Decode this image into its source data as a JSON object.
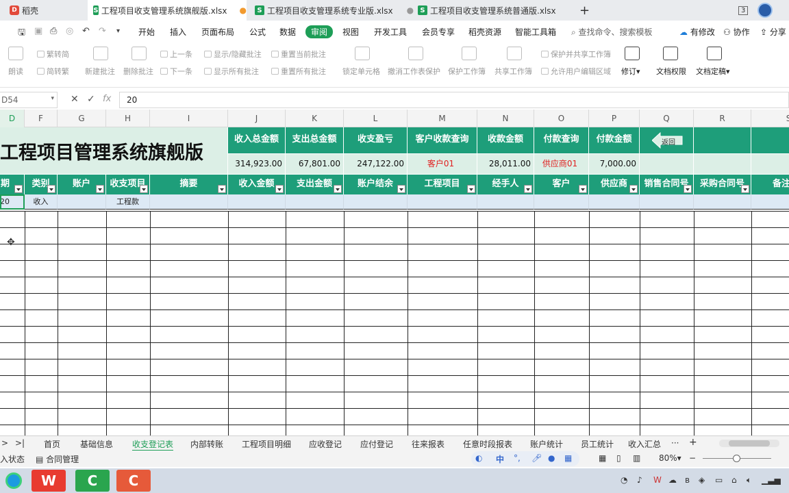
{
  "tabs": [
    {
      "label": "稻壳",
      "type": "docer"
    },
    {
      "label": "工程项目收支管理系统旗舰版.xlsx",
      "active": true,
      "dot": "●"
    },
    {
      "label": "工程项目收支管理系统专业版.xlsx",
      "dot": "●"
    },
    {
      "label": "工程项目收支管理系统普通版.xlsx"
    }
  ],
  "tab_icon": "S",
  "docer_icon": "D",
  "new_tab": "+",
  "tab_count": "3",
  "menu": {
    "items": [
      "开始",
      "插入",
      "页面布局",
      "公式",
      "数据",
      "审阅",
      "视图",
      "开发工具",
      "会员专享",
      "稻壳资源",
      "智能工具箱"
    ],
    "active": "审阅",
    "search": "查找命令、搜索模板",
    "right": [
      "有修改",
      "协作",
      "分享"
    ]
  },
  "ribbon": {
    "read": "朗读",
    "trad": "繁转简",
    "simp": "简转繁",
    "new_comment": "新建批注",
    "del_comment": "删除批注",
    "prev": "上一条",
    "next": "下一条",
    "show_hide": "显示/隐藏批注",
    "show_all": "显示所有批注",
    "reset_cur": "重置当前批注",
    "reset_all": "重置所有批注",
    "lock_cell": "锁定单元格",
    "unprotect": "撤消工作表保护",
    "protect_book": "保护工作簿",
    "share_book": "共享工作簿",
    "protect_share": "保护并共享工作簿",
    "allow_edit": "允许用户编辑区域",
    "revise": "修订",
    "doc_rights": "文档权限",
    "doc_final": "文档定稿"
  },
  "formula": {
    "cell_ref": "D54",
    "value": "20",
    "fx": "fx"
  },
  "columns": [
    "D",
    "F",
    "G",
    "H",
    "I",
    "J",
    "K",
    "L",
    "M",
    "N",
    "O",
    "P",
    "Q",
    "R",
    "S"
  ],
  "banner_title": "工程项目管理系统旗舰版",
  "summary": {
    "headers": [
      "收入总金额",
      "支出总金额",
      "收支盈亏",
      "客户收款查询",
      "收款金额",
      "付款查询",
      "付款金额"
    ],
    "values": [
      "314,923.00",
      "67,801.00",
      "247,122.00",
      "客户01",
      "28,011.00",
      "供应商01",
      "7,000.00"
    ]
  },
  "back_label": "返回",
  "headers": [
    "日期",
    "类别",
    "账户",
    "收支项目",
    "摘要",
    "收入金额",
    "支出金额",
    "账户结余",
    "工程项目",
    "经手人",
    "客户",
    "供应商",
    "销售合同号",
    "采购合同号",
    "备注"
  ],
  "row1": [
    "20",
    "收入",
    "",
    "工程款",
    "",
    "",
    "",
    "",
    "",
    "",
    "",
    "",
    "",
    "",
    ""
  ],
  "sheets": [
    "首页",
    "基础信息",
    "收支登记表",
    "内部转账",
    "工程项目明细",
    "应收登记",
    "应付登记",
    "往来报表",
    "任意时段报表",
    "账户统计",
    "员工统计",
    "收入汇总"
  ],
  "active_sheet": "收支登记表",
  "more_sheets": "···",
  "status": {
    "left": "输入状态",
    "contract": "合同管理",
    "zoom": "80%"
  },
  "lang": "中",
  "colors": {
    "accent": "#1e9e57",
    "header": "#1e9e7a",
    "banner": "#dcefe6",
    "red": "#e02020"
  }
}
